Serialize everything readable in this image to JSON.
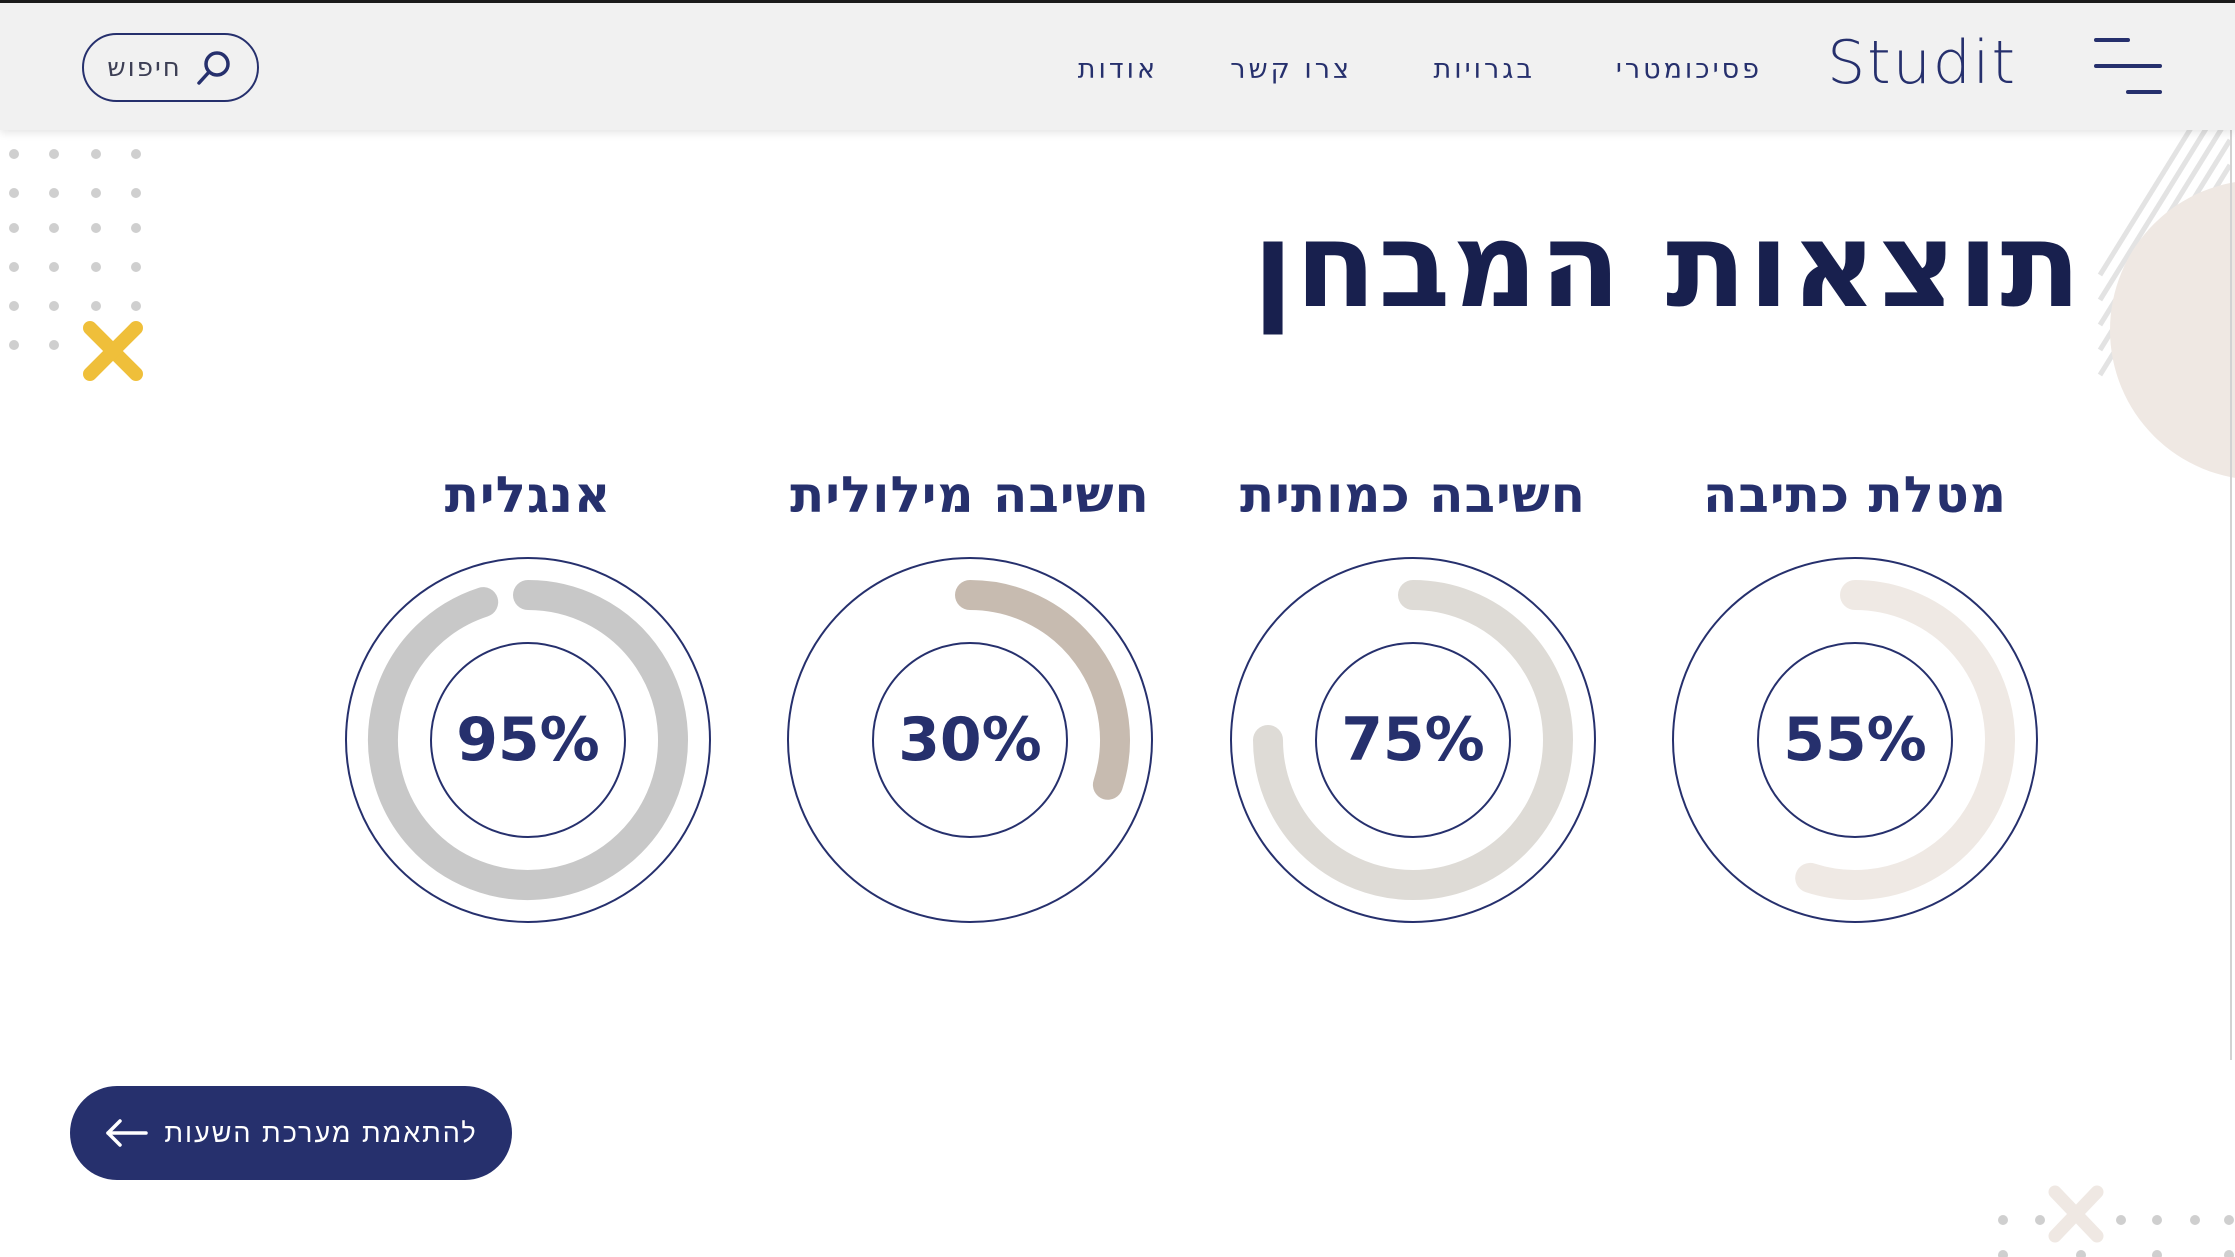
{
  "header": {
    "logo": "Studit",
    "nav": [
      {
        "label": "פסיכומטרי",
        "id": "psychometric"
      },
      {
        "label": "בגרויות",
        "id": "bagrut"
      },
      {
        "label": "צרו קשר",
        "id": "contact"
      },
      {
        "label": "אודות",
        "id": "about"
      }
    ],
    "search": {
      "placeholder": "חיפוש"
    }
  },
  "main": {
    "title": "תוצאות המבחן",
    "scores": [
      {
        "label": "מטלת כתיבה",
        "percent": 55,
        "percent_text": "55%",
        "color": "#efe9e4"
      },
      {
        "label": "חשיבה כמותית",
        "percent": 75,
        "percent_text": "75%",
        "color": "#dedbd6"
      },
      {
        "label": "חשיבה מילולית",
        "percent": 30,
        "percent_text": "30%",
        "color": "#c7bbb0"
      },
      {
        "label": "אנגלית",
        "percent": 95,
        "percent_text": "95%",
        "color": "#c8c8c8"
      }
    ],
    "cta": {
      "label": "להתאמת מערכת השעות"
    }
  },
  "colors": {
    "primary": "#26306d",
    "title": "#18204e",
    "accent_yellow": "#efbf3a",
    "header_bg": "#f1f1f1",
    "deco_beige": "#efe8e3"
  },
  "icons": {
    "menu": "hamburger-menu-icon",
    "search": "search-icon",
    "cta_arrow": "arrow-left-icon"
  }
}
